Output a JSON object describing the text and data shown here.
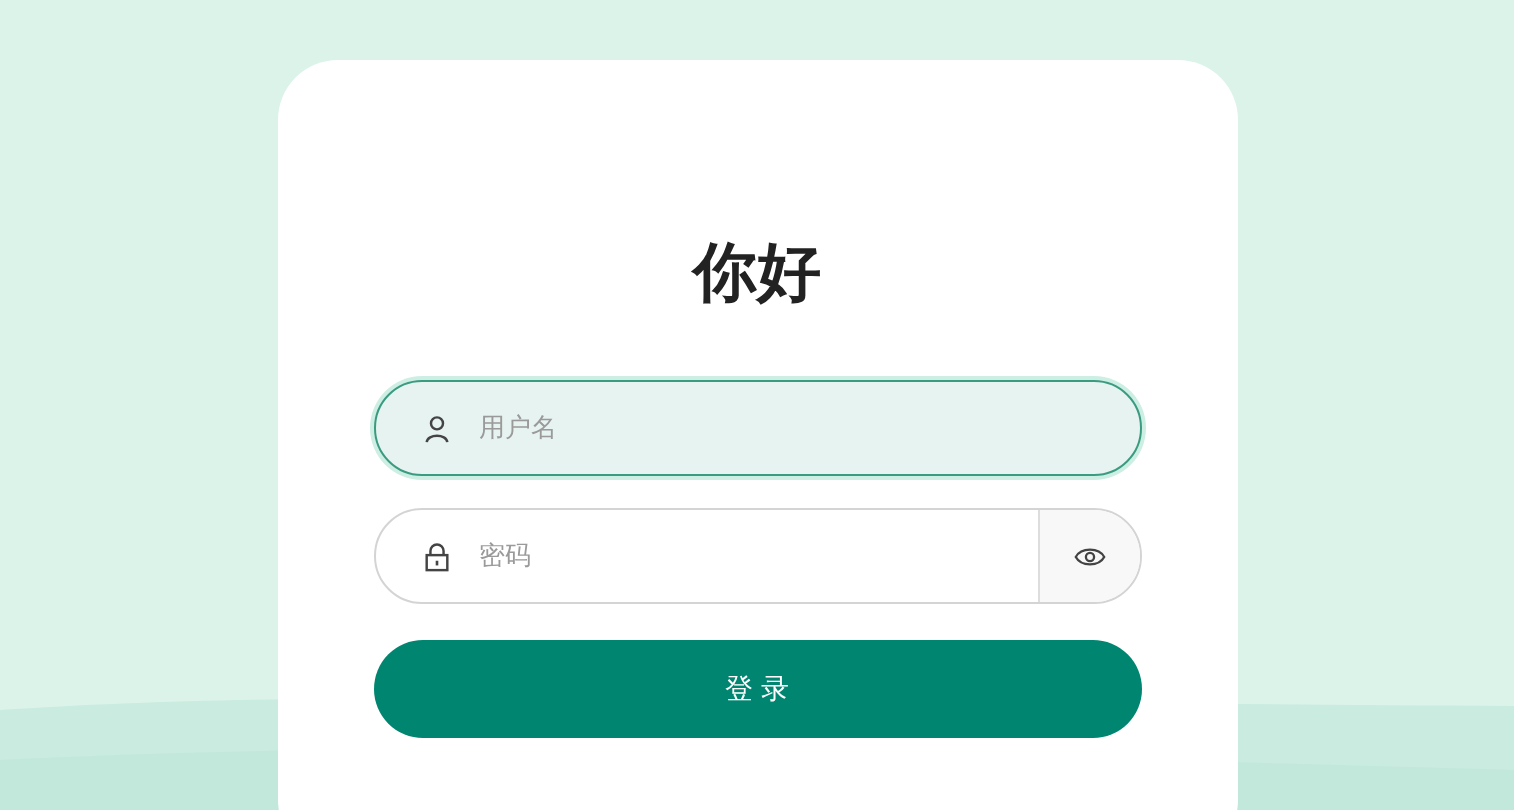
{
  "title": "你好",
  "username": {
    "placeholder": "用户名",
    "focused": true
  },
  "password": {
    "placeholder": "密码"
  },
  "login_button": {
    "label": "登 录"
  }
}
